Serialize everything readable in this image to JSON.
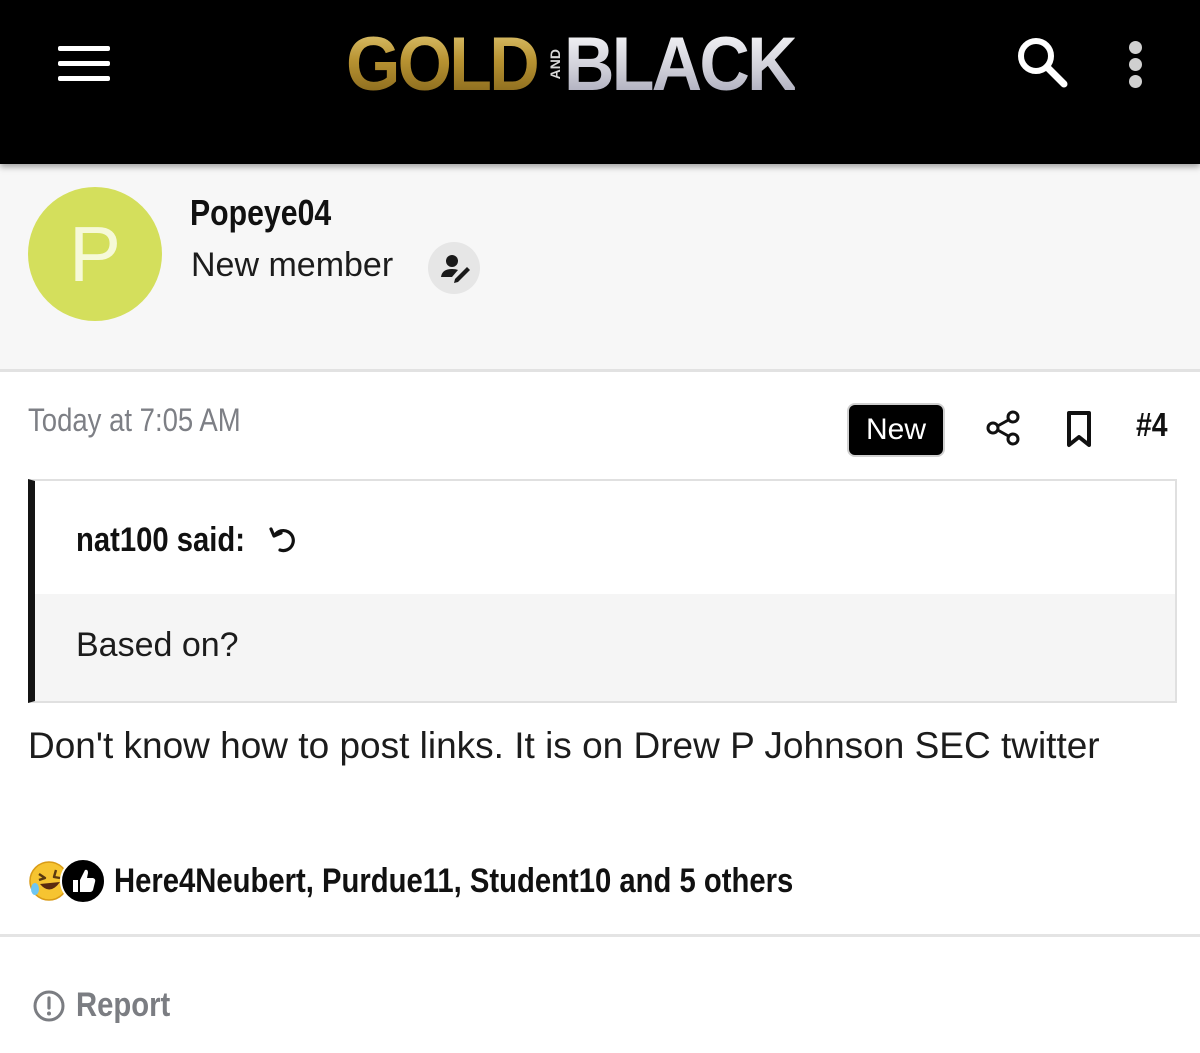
{
  "header": {
    "logo": {
      "left": "GOLD",
      "middle": "AND",
      "right": "BLACK"
    },
    "icons": {
      "menu": "hamburger-menu-icon",
      "search": "search-icon",
      "more": "more-vertical-icon"
    }
  },
  "author": {
    "avatar_letter": "P",
    "avatar_color": "#d4df5c",
    "username": "Popeye04",
    "title": "New member",
    "edit_icon": "user-edit-icon"
  },
  "post": {
    "timestamp": "Today at 7:05 AM",
    "badge": "New",
    "number": "#4",
    "quote": {
      "author_line": "nat100 said:",
      "text": "Based on?"
    },
    "message": "Don't know how to post links. It is on Drew P Johnson SEC twitter",
    "reactions": {
      "icons": [
        "laughing-face-icon",
        "thumbs-up-icon"
      ],
      "text": "Here4Neubert, Purdue11, Student10 and 5 others"
    },
    "report_label": "Report"
  },
  "colors": {
    "header_bg": "#000000",
    "author_bg": "#f7f7f7",
    "meta_text": "#7d7f85",
    "quote_bg": "#f5f5f5"
  }
}
